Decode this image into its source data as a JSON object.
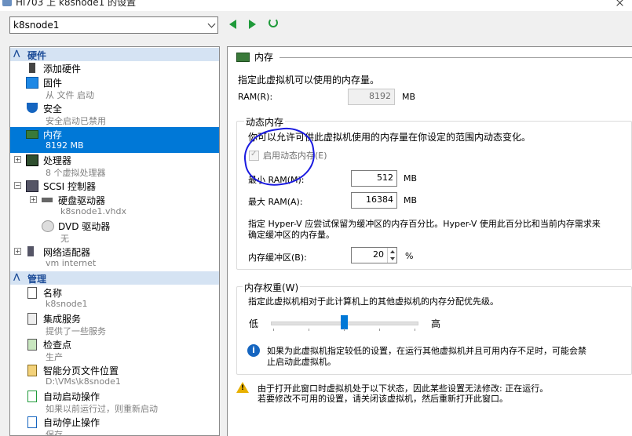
{
  "window": {
    "title": "Hi703 上 k8snode1 的设置"
  },
  "vm_selector": {
    "value": "k8snode1"
  },
  "tree": {
    "hardware_header": "硬件",
    "management_header": "管理",
    "items": [
      {
        "label": "添加硬件",
        "sub": ""
      },
      {
        "label": "固件",
        "sub": "从 文件 启动"
      },
      {
        "label": "安全",
        "sub": "安全启动已禁用"
      },
      {
        "label": "内存",
        "sub": "8192 MB"
      },
      {
        "label": "处理器",
        "sub": "8 个虚拟处理器"
      },
      {
        "label": "SCSI 控制器",
        "sub": ""
      },
      {
        "label": "硬盘驱动器",
        "sub": "k8snode1.vhdx"
      },
      {
        "label": "DVD 驱动器",
        "sub": "无"
      },
      {
        "label": "网络适配器",
        "sub": "vm internet"
      }
    ],
    "mgmt_items": [
      {
        "label": "名称",
        "sub": "k8snode1"
      },
      {
        "label": "集成服务",
        "sub": "提供了一些服务"
      },
      {
        "label": "检查点",
        "sub": "生产"
      },
      {
        "label": "智能分页文件位置",
        "sub": "D:\\VMs\\k8snode1"
      },
      {
        "label": "自动启动操作",
        "sub": "如果以前运行过，则重新启动"
      },
      {
        "label": "自动停止操作",
        "sub": "保存"
      }
    ]
  },
  "memory": {
    "section_title": "内存",
    "description": "指定此虚拟机可以使用的内存量。",
    "ram_label": "RAM(R):",
    "ram_value": "8192",
    "unit_mb": "MB",
    "dynamic_title": "动态内存",
    "dynamic_desc": "你可以允许可供此虚拟机使用的内存量在你设定的范围内动态变化。",
    "enable_dynamic_label": "启用动态内存(E)",
    "enable_dynamic_checked": true,
    "min_label": "最小 RAM(M):",
    "min_value": "512",
    "max_label": "最大 RAM(A):",
    "max_value": "16384",
    "buffer_desc_1": "指定 Hyper-V 应尝试保留为缓冲区的内存百分比。Hyper-V 使用此百分比和当前内存需求来",
    "buffer_desc_2": "确定缓冲区的内存量。",
    "buffer_label": "内存缓冲区(B):",
    "buffer_value": "20",
    "unit_pct": "%",
    "weight_title": "内存权重(W)",
    "weight_desc": "指定此虚拟机相对于此计算机上的其他虚拟机的内存分配优先级。",
    "weight_low": "低",
    "weight_high": "高",
    "weight_level": 0.5,
    "info_text_1": "如果为此虚拟机指定较低的设置，在运行其他虚拟机并且可用内存不足时，可能会禁",
    "info_text_2": "止启动此虚拟机。",
    "warning_1": "由于打开此窗口时虚拟机处于以下状态，因此某些设置无法修改: 正在运行。",
    "warning_2": "若要修改不可用的设置，请关闭该虚拟机，然后重新打开此窗口。"
  },
  "colors": {
    "selection": "#0078d7",
    "section_text": "#1f4e99",
    "accent_green": "#1f9a3a"
  }
}
